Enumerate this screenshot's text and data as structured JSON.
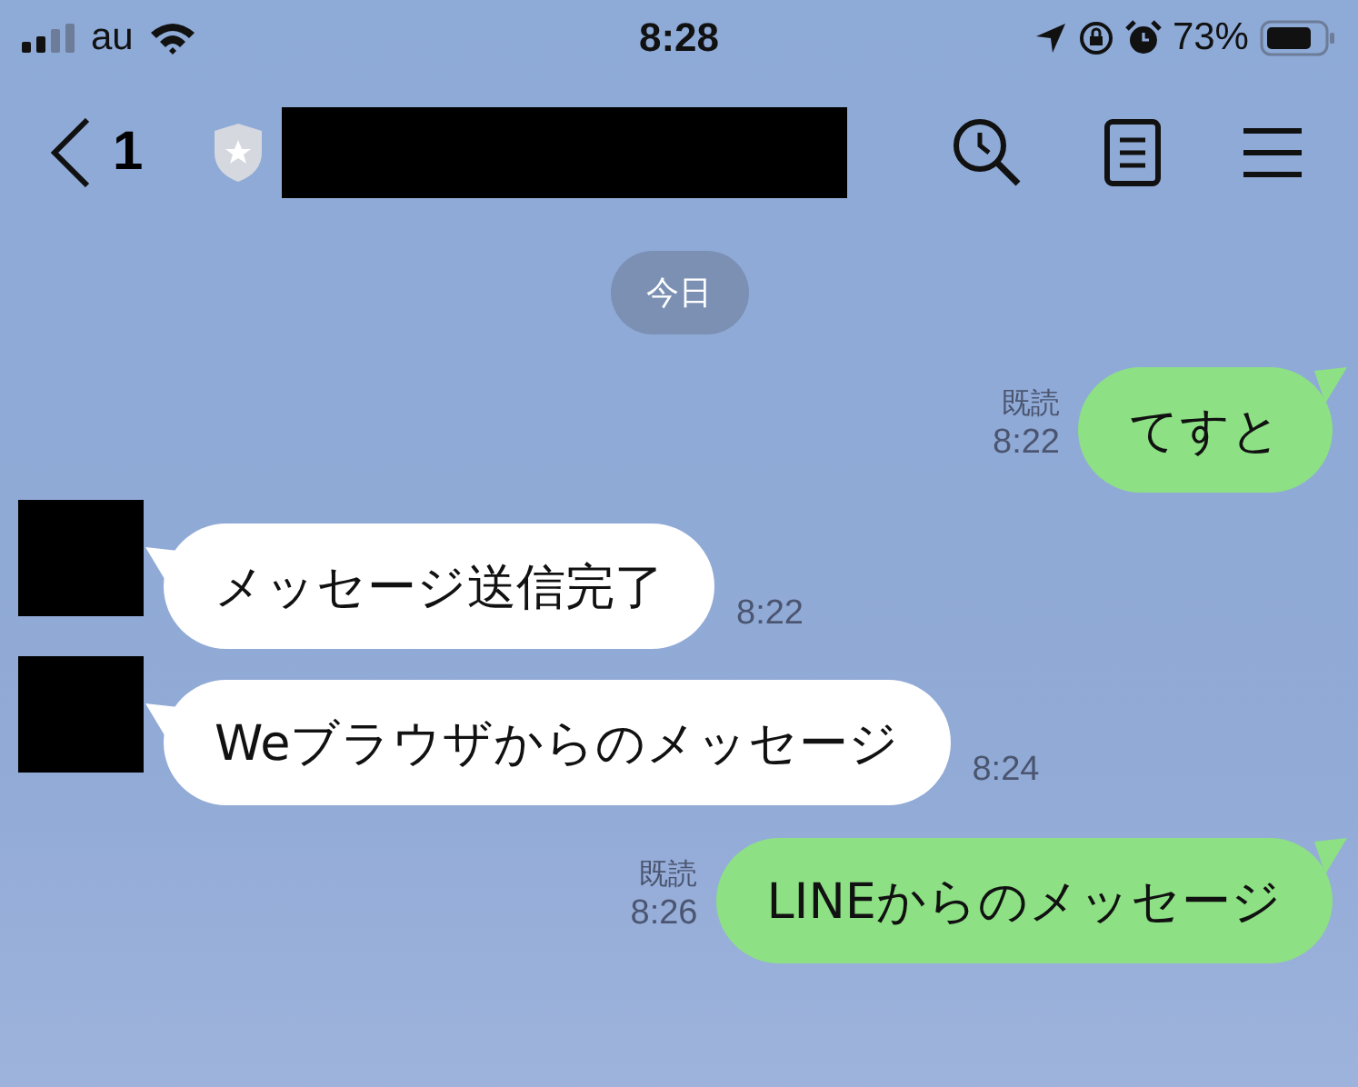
{
  "status_bar": {
    "carrier": "au",
    "time": "8:28",
    "battery": "73%"
  },
  "header": {
    "unread_count": "1"
  },
  "date_label": "今日",
  "messages": [
    {
      "kind": "sent",
      "text": "てすと",
      "read": "既読",
      "time": "8:22"
    },
    {
      "kind": "received",
      "text": "メッセージ送信完了",
      "time": "8:22"
    },
    {
      "kind": "received",
      "text": "Weブラウザからのメッセージ",
      "time": "8:24"
    },
    {
      "kind": "sent",
      "text": "LINEからのメッセージ",
      "read": "既読",
      "time": "8:26"
    }
  ]
}
